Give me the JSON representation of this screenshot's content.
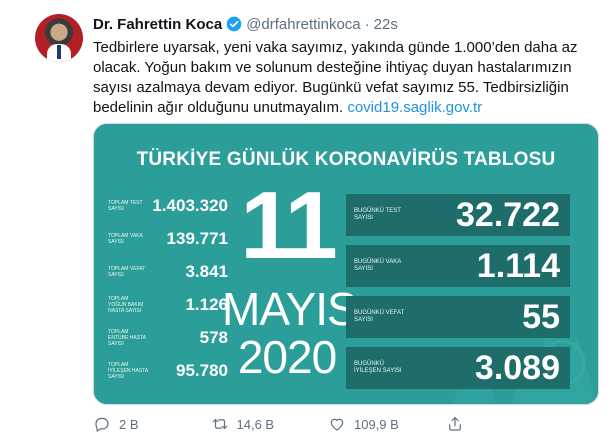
{
  "tweet": {
    "author_name": "Dr. Fahrettin Koca",
    "handle": "@drfahrettinkoca",
    "separator": "·",
    "time": "22s",
    "text": "Tedbirlere uyarsak, yeni vaka sayımız, yakında günde 1.000’den daha az olacak. Yoğun bakım ve solunum desteğine ihtiyaç duyan hastalarımızın sayısı azalmaya devam ediyor. Bugünkü vefat sayımız 55. Tedbirsizliğin bedelinin ağır olduğunu unutmayalım. ",
    "link": "covid19.saglik.gov.tr"
  },
  "card": {
    "title": "TÜRKİYE GÜNLÜK KORONAVİRÜS TABLOSU",
    "day": "11",
    "month": "MAYIS",
    "year": "2020",
    "totals": [
      {
        "label": "TOPLAM TEST SAYISI",
        "value": "1.403.320"
      },
      {
        "label": "TOPLAM VAKA SAYISI",
        "value": "139.771"
      },
      {
        "label": "TOPLAM VEFAT SAYISI",
        "value": "3.841"
      },
      {
        "label": "TOPLAM YOĞUN BAKIM HASTA SAYISI",
        "value": "1.126"
      },
      {
        "label": "TOPLAM ENTÜBE HASTA SAYISI",
        "value": "578"
      },
      {
        "label": "TOPLAM İYİLEŞEN HASTA SAYISI",
        "value": "95.780"
      }
    ],
    "today": [
      {
        "label": "BUGÜNKÜ TEST SAYISI",
        "value": "32.722"
      },
      {
        "label": "BUGÜNKÜ VAKA SAYISI",
        "value": "1.114"
      },
      {
        "label": "BUGÜNKÜ VEFAT SAYISI",
        "value": "55"
      },
      {
        "label": "BUGÜNKÜ İYİLEŞEN SAYISI",
        "value": "3.089"
      }
    ]
  },
  "actions": {
    "reply_count": "2 B",
    "retweet_count": "14,6 B",
    "like_count": "109,9 B"
  },
  "colors": {
    "card_bg": "#2b9e9a",
    "box_bg": "#1f6d6a",
    "link": "#1b95e0",
    "verified": "#1da1f2",
    "muted": "#5b7083"
  }
}
